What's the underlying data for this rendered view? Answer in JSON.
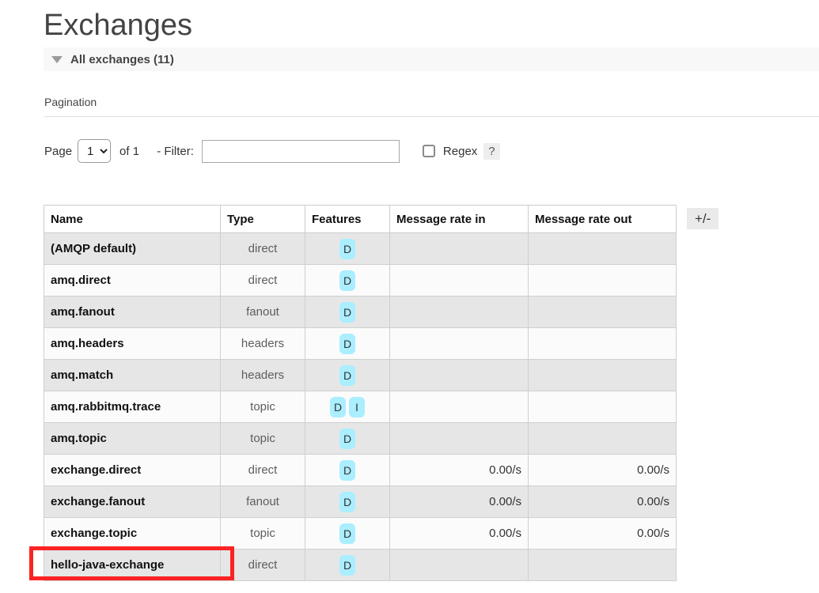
{
  "page": {
    "title": "Exchanges"
  },
  "section": {
    "collapse_icon": "triangle-down-icon",
    "label": "All exchanges (11)"
  },
  "pagination": {
    "heading": "Pagination",
    "page_word": "Page",
    "page_value": "1",
    "page_options": [
      "1"
    ],
    "of_text": "of 1",
    "filter_label": " - Filter:",
    "filter_value": "",
    "filter_placeholder": "",
    "regex_checked": false,
    "regex_label": "Regex",
    "help_label": "?"
  },
  "table": {
    "columns": [
      "Name",
      "Type",
      "Features",
      "Message rate in",
      "Message rate out"
    ],
    "toggle_columns_label": "+/-",
    "rows": [
      {
        "name": "(AMQP default)",
        "type": "direct",
        "features": [
          "D"
        ],
        "rate_in": "",
        "rate_out": ""
      },
      {
        "name": "amq.direct",
        "type": "direct",
        "features": [
          "D"
        ],
        "rate_in": "",
        "rate_out": ""
      },
      {
        "name": "amq.fanout",
        "type": "fanout",
        "features": [
          "D"
        ],
        "rate_in": "",
        "rate_out": ""
      },
      {
        "name": "amq.headers",
        "type": "headers",
        "features": [
          "D"
        ],
        "rate_in": "",
        "rate_out": ""
      },
      {
        "name": "amq.match",
        "type": "headers",
        "features": [
          "D"
        ],
        "rate_in": "",
        "rate_out": ""
      },
      {
        "name": "amq.rabbitmq.trace",
        "type": "topic",
        "features": [
          "D",
          "I"
        ],
        "rate_in": "",
        "rate_out": ""
      },
      {
        "name": "amq.topic",
        "type": "topic",
        "features": [
          "D"
        ],
        "rate_in": "",
        "rate_out": ""
      },
      {
        "name": "exchange.direct",
        "type": "direct",
        "features": [
          "D"
        ],
        "rate_in": "0.00/s",
        "rate_out": "0.00/s"
      },
      {
        "name": "exchange.fanout",
        "type": "fanout",
        "features": [
          "D"
        ],
        "rate_in": "0.00/s",
        "rate_out": "0.00/s"
      },
      {
        "name": "exchange.topic",
        "type": "topic",
        "features": [
          "D"
        ],
        "rate_in": "0.00/s",
        "rate_out": "0.00/s"
      },
      {
        "name": "hello-java-exchange",
        "type": "direct",
        "features": [
          "D"
        ],
        "rate_in": "",
        "rate_out": ""
      }
    ]
  },
  "annotation": {
    "color": "#fb2323",
    "target_row": "hello-java-exchange"
  },
  "colors": {
    "feature_badge": "#aaeeff",
    "row_odd": "#e6e6e6",
    "row_even": "#fbfbfb",
    "band": "#f8f8f8"
  }
}
